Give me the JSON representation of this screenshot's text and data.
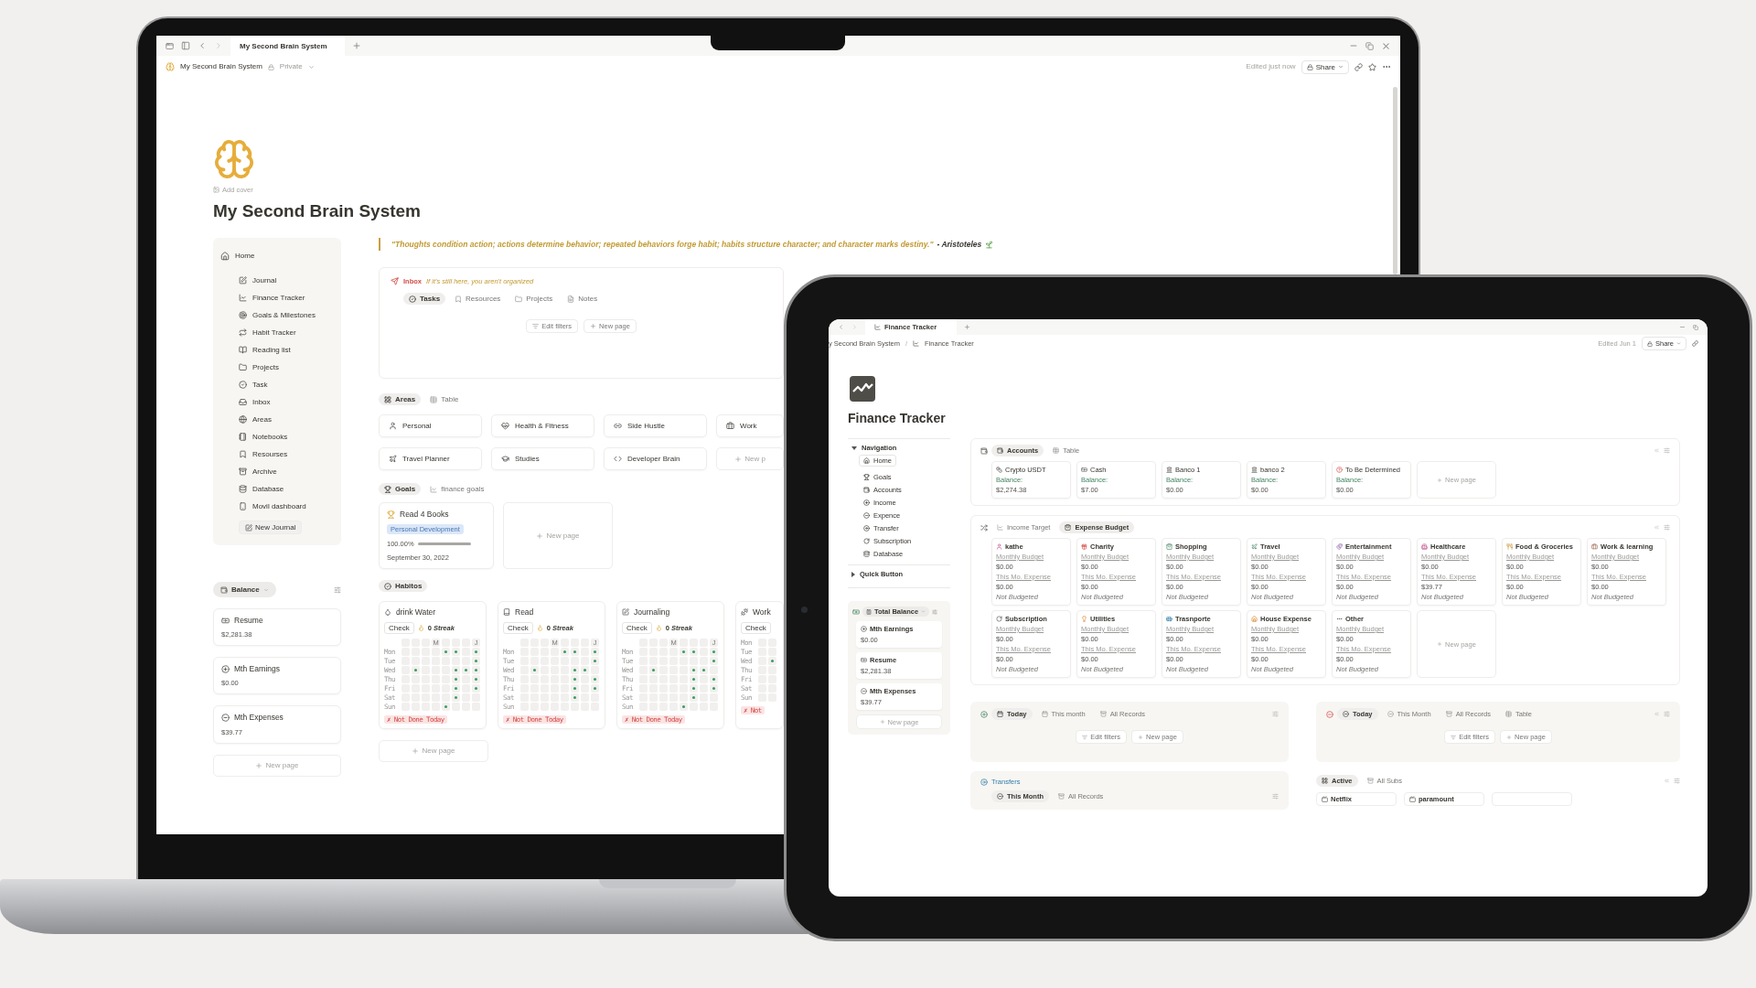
{
  "laptop": {
    "browser_tab": "My Second Brain System",
    "breadcrumb": "My Second Brain System",
    "privacy": "Private",
    "edited": "Edited just now",
    "share": "Share",
    "add_cover": "Add cover",
    "title": "My Second Brain System",
    "quote": "\"Thoughts condition action;  actions determine behavior;  repeated behaviors forge habit;  habits structure character;  and character marks destiny.\"",
    "quote_author": "- Aristoteles",
    "nav": {
      "home": "Home",
      "items": [
        "Journal",
        "Finance Tracker",
        "Goals & Milestones",
        "Habit Tracker",
        "Reading list",
        "Projects",
        "Task",
        "Inbox",
        "Areas",
        "Notebooks",
        "Resourses",
        "Archive",
        "Database",
        "Movil dashboard"
      ],
      "new_journal": "New Journal"
    },
    "balance": {
      "label": "Balance",
      "cards": [
        {
          "title": "Resume",
          "amount": "$2,281.38"
        },
        {
          "title": "Mth Earnings",
          "amount": "$0.00"
        },
        {
          "title": "Mth Expenses",
          "amount": "$39.77"
        }
      ],
      "new_page": "New page"
    },
    "inbox": {
      "label": "Inbox",
      "note": "If it's still here, you aren't organized",
      "tabs": [
        {
          "label": "Tasks",
          "selected": true
        },
        {
          "label": "Resources",
          "selected": false
        },
        {
          "label": "Projects",
          "selected": false
        },
        {
          "label": "Notes",
          "selected": false
        }
      ],
      "edit_filters": "Edit filters",
      "new_page": "New page"
    },
    "areas": {
      "tabs": [
        {
          "label": "Areas",
          "selected": true
        },
        {
          "label": "Table",
          "selected": false
        }
      ],
      "cards": [
        "Personal",
        "Health & Fitness",
        "Side Hustle",
        "Work",
        "Travel Planner",
        "Studies",
        "Developer Brain"
      ],
      "new_page": "New p"
    },
    "goals": {
      "tabs": [
        {
          "label": "Goals",
          "selected": true
        },
        {
          "label": "finance goals",
          "selected": false
        }
      ],
      "card": {
        "title": "Read 4 Books",
        "tag": "Personal Development",
        "progress": "100.00%",
        "level": 1,
        "date": "September 30, 2022"
      },
      "new_page": "New page"
    },
    "habits": {
      "tab": {
        "label": "Habitos",
        "selected": true
      },
      "new_page": "New page",
      "cards": [
        {
          "title": "drink Water",
          "check": "Check",
          "streak": "0 *Streak*",
          "month_labels": [
            "M",
            "J"
          ],
          "status": "✗ Not Done Today",
          "days": [
            {
              "day": "Mon",
              "done": [
                false,
                false,
                false,
                false,
                true,
                true,
                false,
                true
              ]
            },
            {
              "day": "Tue",
              "done": [
                false,
                false,
                false,
                false,
                false,
                false,
                false,
                true
              ]
            },
            {
              "day": "Wed",
              "done": [
                false,
                true,
                false,
                false,
                false,
                true,
                true,
                true
              ]
            },
            {
              "day": "Thu",
              "done": [
                false,
                false,
                false,
                false,
                false,
                true,
                false,
                true
              ]
            },
            {
              "day": "Fri",
              "done": [
                false,
                false,
                false,
                false,
                false,
                true,
                false,
                true
              ]
            },
            {
              "day": "Sat",
              "done": [
                false,
                false,
                false,
                false,
                false,
                true,
                false,
                false
              ]
            },
            {
              "day": "Sun",
              "done": [
                false,
                false,
                false,
                false,
                true,
                false,
                false,
                false
              ]
            }
          ]
        },
        {
          "title": "Read",
          "check": "Check",
          "streak": "0 *Streak*",
          "month_labels": [
            "M",
            "J"
          ],
          "status": "✗ Not Done Today",
          "days": [
            {
              "day": "Mon",
              "done": [
                false,
                false,
                false,
                false,
                true,
                true,
                false,
                true
              ]
            },
            {
              "day": "Tue",
              "done": [
                false,
                false,
                false,
                false,
                false,
                false,
                false,
                true
              ]
            },
            {
              "day": "Wed",
              "done": [
                false,
                true,
                false,
                false,
                false,
                true,
                true,
                false
              ]
            },
            {
              "day": "Thu",
              "done": [
                false,
                false,
                false,
                false,
                false,
                true,
                false,
                true
              ]
            },
            {
              "day": "Fri",
              "done": [
                false,
                false,
                false,
                false,
                false,
                true,
                false,
                true
              ]
            },
            {
              "day": "Sat",
              "done": [
                false,
                false,
                false,
                false,
                false,
                true,
                false,
                false
              ]
            },
            {
              "day": "Sun",
              "done": [
                false,
                false,
                false,
                false,
                false,
                false,
                false,
                false
              ]
            }
          ]
        },
        {
          "title": "Journaling",
          "check": "Check",
          "streak": "0 *Streak*",
          "month_labels": [
            "M",
            "J"
          ],
          "status": "✗ Not Done Today",
          "days": [
            {
              "day": "Mon",
              "done": [
                false,
                false,
                false,
                false,
                true,
                true,
                false,
                true
              ]
            },
            {
              "day": "Tue",
              "done": [
                false,
                false,
                false,
                false,
                false,
                false,
                false,
                true
              ]
            },
            {
              "day": "Wed",
              "done": [
                false,
                true,
                false,
                false,
                false,
                true,
                true,
                false
              ]
            },
            {
              "day": "Thu",
              "done": [
                false,
                false,
                false,
                false,
                false,
                true,
                false,
                true
              ]
            },
            {
              "day": "Fri",
              "done": [
                false,
                false,
                false,
                false,
                false,
                true,
                false,
                true
              ]
            },
            {
              "day": "Sat",
              "done": [
                false,
                false,
                false,
                false,
                false,
                true,
                false,
                false
              ]
            },
            {
              "day": "Sun",
              "done": [
                false,
                false,
                false,
                false,
                true,
                false,
                false,
                false
              ]
            }
          ]
        },
        {
          "title": "Work",
          "check": "Check",
          "status": "✗ Not",
          "days": [
            {
              "day": "Mon",
              "done": [
                false,
                false
              ]
            },
            {
              "day": "Tue",
              "done": [
                false,
                false
              ]
            },
            {
              "day": "Wed",
              "done": [
                false,
                true
              ]
            },
            {
              "day": "Thu",
              "done": [
                false,
                false
              ]
            },
            {
              "day": "Fri",
              "done": [
                false,
                false
              ]
            },
            {
              "day": "Sat",
              "done": [
                false,
                false
              ]
            },
            {
              "day": "Sun",
              "done": [
                false,
                false
              ]
            }
          ]
        }
      ]
    }
  },
  "tablet": {
    "browser_tab": "Finance Tracker",
    "breadcrumb": [
      "y Second Brain System",
      "Finance Tracker"
    ],
    "breadcrumb_separator": "/",
    "edited": "Edited Jun 1",
    "share": "Share",
    "title": "Finance Tracker",
    "nav": {
      "heading": "Navigation",
      "expanded": true,
      "items": [
        {
          "label": "Home",
          "selected": true
        },
        {
          "label": "Goals",
          "selected": false
        },
        {
          "label": "Accounts",
          "selected": false
        },
        {
          "label": "Income",
          "selected": false
        },
        {
          "label": "Expence",
          "selected": false
        },
        {
          "label": "Transfer",
          "selected": false
        },
        {
          "label": "Subscription",
          "selected": false
        },
        {
          "label": "Database",
          "selected": false
        }
      ]
    },
    "quick_button": {
      "label": "Quick Button",
      "expanded": false
    },
    "total_balance": {
      "label": "Total Balance",
      "cards": [
        {
          "title": "Mth Earnings",
          "amount": "$0.00"
        },
        {
          "title": "Resume",
          "amount": "$2,281.38"
        },
        {
          "title": "Mth Expenses",
          "amount": "$39.77"
        }
      ],
      "new_page": "New page"
    },
    "accounts": {
      "tabs": [
        {
          "label": "Accounts",
          "selected": true
        },
        {
          "label": "Table",
          "selected": false
        }
      ],
      "new_page": "New page",
      "cards": [
        {
          "title": "Crypto USDT",
          "balance_label": "Balance:",
          "amount": "$2,274.38"
        },
        {
          "title": "Cash",
          "balance_label": "Balance:",
          "amount": "$7.00"
        },
        {
          "title": "Banco 1",
          "balance_label": "Balance:",
          "amount": "$0.00"
        },
        {
          "title": "banco 2",
          "balance_label": "Balance:",
          "amount": "$0.00"
        },
        {
          "title": "To Be Determined",
          "balance_label": "Balance:",
          "amount": "$0.00"
        }
      ]
    },
    "budget": {
      "tabs": [
        {
          "label": "Income Target",
          "selected": false
        },
        {
          "label": "Expense Budget",
          "selected": true
        }
      ],
      "new_page": "New page",
      "cards": [
        {
          "title": "kathe",
          "budget_label": "Monthly Budget",
          "budget": "$0.00",
          "expense_label": "This Mo. Expense",
          "expense": "$0.00",
          "status": "Not Budgeted"
        },
        {
          "title": "Charity",
          "budget_label": "Monthly Budget",
          "budget": "$0.00",
          "expense_label": "This Mo. Expense",
          "expense": "$0.00",
          "status": "Not Budgeted"
        },
        {
          "title": "Shopping",
          "budget_label": "Monthly Budget",
          "budget": "$0.00",
          "expense_label": "This Mo. Expense",
          "expense": "$0.00",
          "status": "Not Budgeted"
        },
        {
          "title": "Travel",
          "budget_label": "Monthly Budget",
          "budget": "$0.00",
          "expense_label": "This Mo. Expense",
          "expense": "$0.00",
          "status": "Not Budgeted"
        },
        {
          "title": "Entertainment",
          "budget_label": "Monthly Budget",
          "budget": "$0.00",
          "expense_label": "This Mo. Expense",
          "expense": "$0.00",
          "status": "Not Budgeted"
        },
        {
          "title": "Healthcare",
          "budget_label": "Monthly Budget",
          "budget": "$0.00",
          "expense_label": "This Mo. Expense",
          "expense": "$39.77",
          "status": "Not Budgeted"
        },
        {
          "title": "Food & Groceries",
          "budget_label": "Monthly Budget",
          "budget": "$0.00",
          "expense_label": "This Mo. Expense",
          "expense": "$0.00",
          "status": "Not Budgeted"
        },
        {
          "title": "Work & learning",
          "budget_label": "Monthly Budget",
          "budget": "$0.00",
          "expense_label": "This Mo. Expense",
          "expense": "$0.00",
          "status": "Not Budgeted"
        },
        {
          "title": "Subscription",
          "budget_label": "Monthly Budget",
          "budget": "$0.00",
          "expense_label": "This Mo. Expense",
          "expense": "$0.00",
          "status": "Not Budgeted"
        },
        {
          "title": "Utilities",
          "budget_label": "Monthly Budget",
          "budget": "$0.00",
          "expense_label": "This Mo. Expense",
          "expense": "$0.00",
          "status": "Not Budgeted"
        },
        {
          "title": "Trasnporte",
          "budget_label": "Monthly Budget",
          "budget": "$0.00",
          "expense_label": "This Mo. Expense",
          "expense": "$0.00",
          "status": "Not Budgeted"
        },
        {
          "title": "House Expense",
          "budget_label": "Monthly Budget",
          "budget": "$0.00",
          "expense_label": "This Mo. Expense",
          "expense": "$0.00",
          "status": "Not Budgeted"
        },
        {
          "title": "Other",
          "budget_label": "Monthly Budget",
          "budget": "$0.00",
          "expense_label": "This Mo. Expense",
          "expense": "$0.00",
          "status": "Not Budgeted"
        }
      ]
    },
    "income": {
      "tabs": [
        {
          "label": "Today",
          "selected": true
        },
        {
          "label": "This month",
          "selected": false
        },
        {
          "label": "All Records",
          "selected": false
        }
      ],
      "edit_filters": "Edit filters",
      "new_page": "New page"
    },
    "expenses": {
      "tabs": [
        {
          "label": "Today",
          "selected": true
        },
        {
          "label": "This Month",
          "selected": false
        },
        {
          "label": "All Records",
          "selected": false
        },
        {
          "label": "Table",
          "selected": false
        }
      ],
      "edit_filters": "Edit filters",
      "new_page": "New page"
    },
    "transfers": {
      "label": "Transfers",
      "tabs": [
        {
          "label": "This Month",
          "selected": true
        },
        {
          "label": "All Records",
          "selected": false
        }
      ]
    },
    "subscriptions": {
      "tabs": [
        {
          "label": "Active",
          "selected": true
        },
        {
          "label": "All Subs",
          "selected": false
        }
      ],
      "cards": [
        "Netflix",
        "paramount"
      ]
    }
  }
}
